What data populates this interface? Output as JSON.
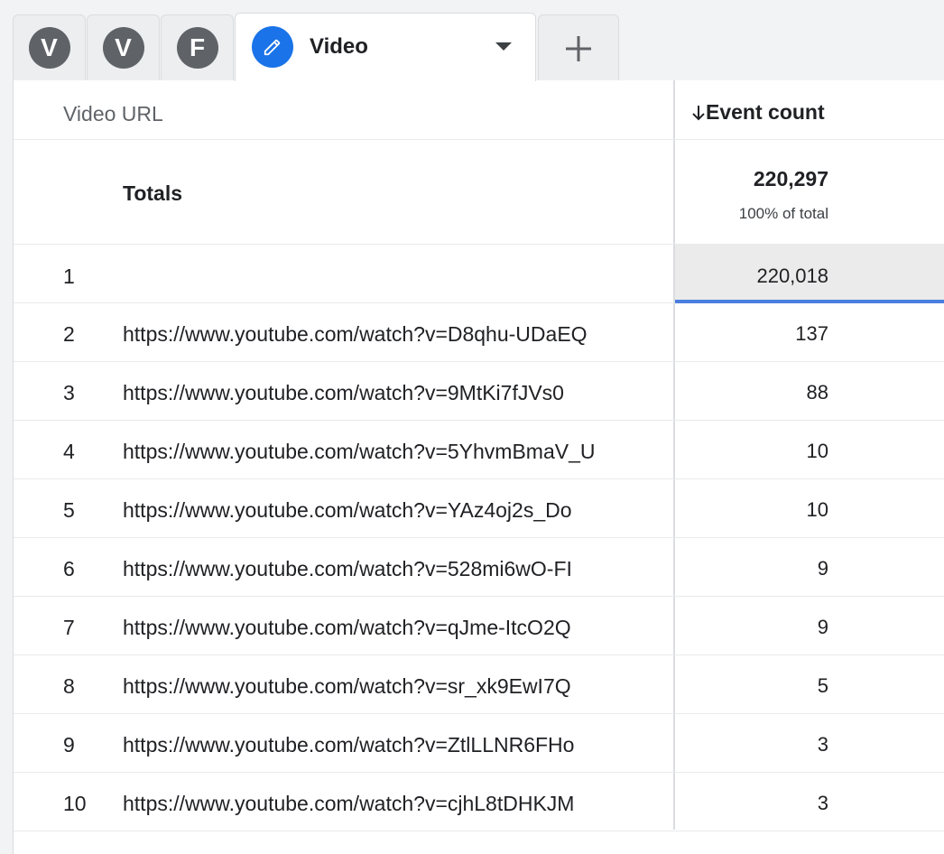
{
  "tabs": {
    "segments": [
      {
        "letter": "V"
      },
      {
        "letter": "V"
      },
      {
        "letter": "F"
      }
    ],
    "active": {
      "title": "Video"
    }
  },
  "table": {
    "columns": {
      "dimension": "Video URL",
      "metric": "Event count"
    },
    "totals": {
      "label": "Totals",
      "value": "220,297",
      "percent": "100% of total"
    },
    "rows": [
      {
        "index": "1",
        "url": "",
        "value": "220,018"
      },
      {
        "index": "2",
        "url": "https://www.youtube.com/watch?v=D8qhu-UDaEQ",
        "value": "137"
      },
      {
        "index": "3",
        "url": "https://www.youtube.com/watch?v=9MtKi7fJVs0",
        "value": "88"
      },
      {
        "index": "4",
        "url": "https://www.youtube.com/watch?v=5YhvmBmaV_U",
        "value": "10"
      },
      {
        "index": "5",
        "url": "https://www.youtube.com/watch?v=YAz4oj2s_Do",
        "value": "10"
      },
      {
        "index": "6",
        "url": "https://www.youtube.com/watch?v=528mi6wO-FI",
        "value": "9"
      },
      {
        "index": "7",
        "url": "https://www.youtube.com/watch?v=qJme-ItcO2Q",
        "value": "9"
      },
      {
        "index": "8",
        "url": "https://www.youtube.com/watch?v=sr_xk9EwI7Q",
        "value": "5"
      },
      {
        "index": "9",
        "url": "https://www.youtube.com/watch?v=ZtlLLNR6FHo",
        "value": "3"
      },
      {
        "index": "10",
        "url": "https://www.youtube.com/watch?v=cjhL8tDHKJM",
        "value": "3"
      }
    ]
  },
  "icons": {
    "edit": "pencil-icon",
    "dropdown": "chevron-down-icon",
    "add": "plus-icon",
    "sort": "arrow-down-icon"
  },
  "colors": {
    "accent": "#1a73e8",
    "avatar": "#5f6368",
    "highlight_bar": "#4a7ee0"
  }
}
